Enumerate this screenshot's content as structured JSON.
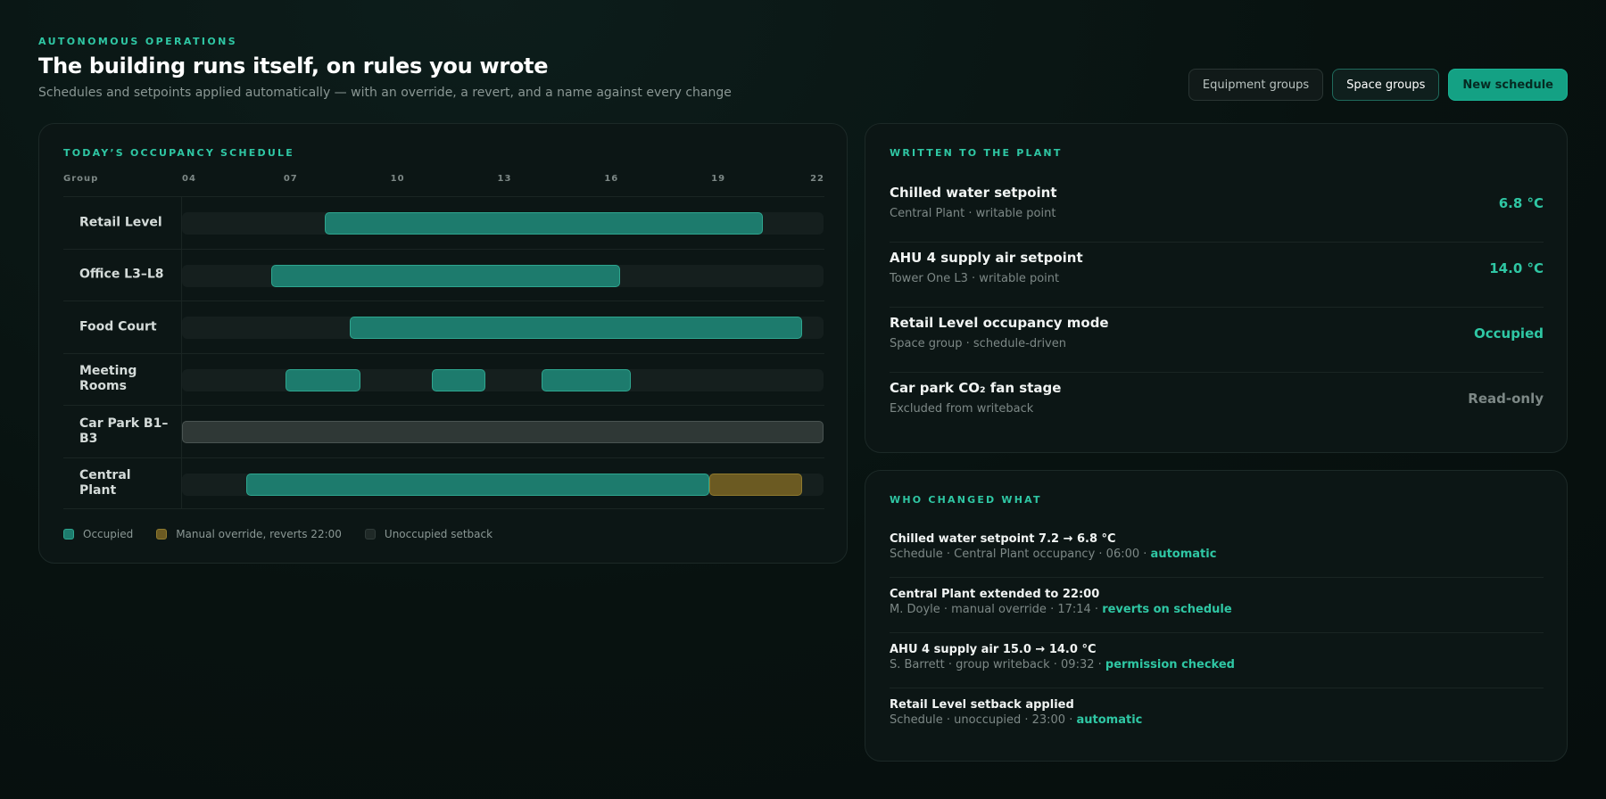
{
  "header": {
    "eyebrow": "AUTONOMOUS OPERATIONS",
    "title": "The building runs itself, on rules you wrote",
    "subtitle": "Schedules and setpoints applied automatically — with an override, a revert, and a name against every change"
  },
  "actions": {
    "equipment_groups": "Equipment groups",
    "space_groups": "Space groups",
    "new_schedule": "New schedule"
  },
  "schedule": {
    "title": "TODAY’S OCCUPANCY SCHEDULE",
    "group_header": "Group",
    "axis_start": 4,
    "axis_end": 22,
    "ticks": [
      "04",
      "07",
      "10",
      "13",
      "16",
      "19",
      "22"
    ],
    "rows": [
      {
        "label": "Retail Level",
        "segments": [
          {
            "type": "occupied",
            "start": 8.0,
            "end": 20.3
          }
        ]
      },
      {
        "label": "Office L3–L8",
        "segments": [
          {
            "type": "occupied",
            "start": 6.5,
            "end": 16.3
          }
        ]
      },
      {
        "label": "Food Court",
        "segments": [
          {
            "type": "occupied",
            "start": 8.7,
            "end": 21.4
          }
        ]
      },
      {
        "label": "Meeting Rooms",
        "segments": [
          {
            "type": "occupied",
            "start": 6.9,
            "end": 9.0
          },
          {
            "type": "occupied",
            "start": 11.0,
            "end": 12.5
          },
          {
            "type": "occupied",
            "start": 14.1,
            "end": 16.6
          }
        ]
      },
      {
        "label": "Car Park B1–B3",
        "segments": [
          {
            "type": "setback",
            "start": 4.0,
            "end": 22.0
          }
        ]
      },
      {
        "label": "Central Plant",
        "segments": [
          {
            "type": "occupied",
            "start": 5.8,
            "end": 18.8
          },
          {
            "type": "override",
            "start": 18.8,
            "end": 21.4
          }
        ]
      }
    ],
    "legend": {
      "occupied": "Occupied",
      "override": "Manual override, reverts 22:00",
      "setback": "Unoccupied setback"
    }
  },
  "plant": {
    "title": "WRITTEN TO THE PLANT",
    "items": [
      {
        "name": "Chilled water setpoint",
        "meta": "Central Plant · writable point",
        "value": "6.8 °C"
      },
      {
        "name": "AHU 4 supply air setpoint",
        "meta": "Tower One L3 · writable point",
        "value": "14.0 °C"
      },
      {
        "name": "Retail Level occupancy mode",
        "meta": "Space group · schedule-driven",
        "value": "Occupied"
      },
      {
        "name": "Car park CO₂ fan stage",
        "meta": "Excluded from writeback",
        "value": "Read-only"
      }
    ]
  },
  "changes": {
    "title": "WHO CHANGED WHAT",
    "items": [
      {
        "title": "Chilled water setpoint 7.2 → 6.8 °C",
        "meta": "Schedule · Central Plant occupancy · 06:00 · ",
        "tag": "automatic"
      },
      {
        "title": "Central Plant extended to 22:00",
        "meta": "M. Doyle · manual override · 17:14 · ",
        "tag": "reverts on schedule"
      },
      {
        "title": "AHU 4 supply air 15.0 → 14.0 °C",
        "meta": "S. Barrett · group writeback · 09:32 · ",
        "tag": "permission checked"
      },
      {
        "title": "Retail Level setback applied",
        "meta": "Schedule · unoccupied · 23:00 · ",
        "tag": "automatic"
      }
    ]
  }
}
